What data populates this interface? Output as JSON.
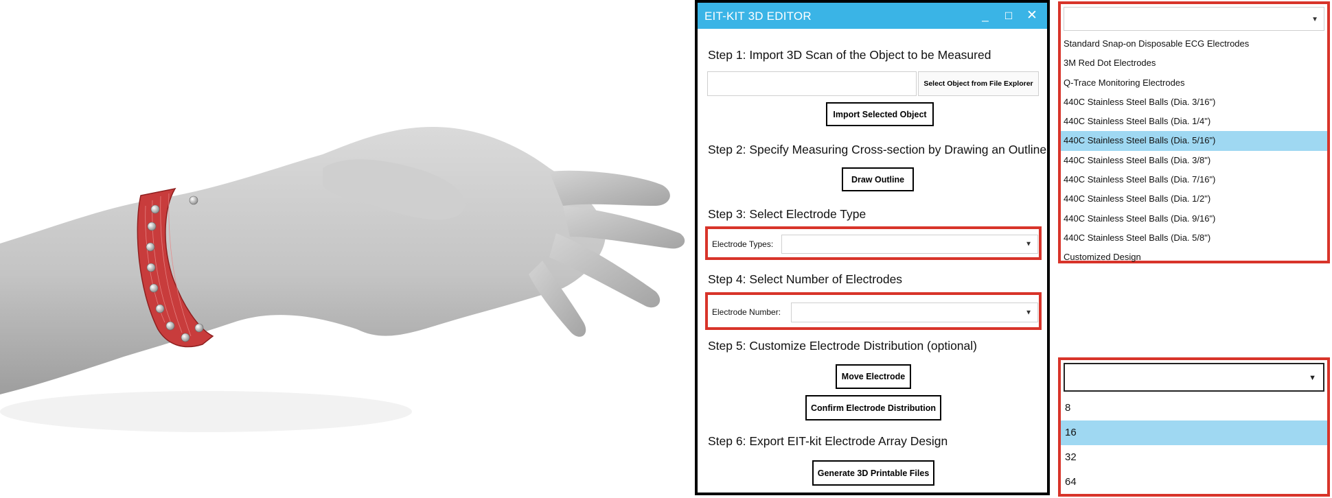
{
  "window": {
    "title": "EIT-KIT 3D EDITOR",
    "min_icon": "minimize-icon",
    "max_icon": "maximize-icon",
    "close_icon": "close-icon"
  },
  "step1": {
    "label": "Step 1: Import 3D Scan of the Object to be Measured",
    "file_value": "",
    "file_button": "Select Object from File Explorer",
    "import_button": "Import Selected Object"
  },
  "step2": {
    "label": "Step 2: Specify Measuring Cross-section by Drawing an Outline",
    "button": "Draw Outline"
  },
  "step3": {
    "label": "Step 3: Select Electrode Type",
    "field_label": "Electrode Types:",
    "value": ""
  },
  "step4": {
    "label": "Step 4: Select Number of Electrodes",
    "field_label": "Electrode Number:",
    "value": ""
  },
  "step5": {
    "label": "Step 5: Customize Electrode Distribution (optional)",
    "move_button": "Move Electrode",
    "confirm_button": "Confirm Electrode Distribution"
  },
  "step6": {
    "label": "Step 6: Export EIT-kit Electrode Array Design",
    "button": "Generate 3D Printable Files"
  },
  "electrode_types_dropdown": {
    "items": [
      "Standard Snap-on Disposable ECG Electrodes",
      "3M Red Dot Electrodes",
      "Q-Trace Monitoring Electrodes",
      "440C Stainless Steel Balls (Dia. 3/16\")",
      "440C Stainless Steel Balls (Dia. 1/4\")",
      "440C Stainless Steel Balls (Dia. 5/16\")",
      "440C Stainless Steel Balls (Dia. 3/8\")",
      "440C Stainless Steel Balls (Dia. 7/16\")",
      "440C Stainless Steel Balls (Dia. 1/2\")",
      "440C Stainless Steel Balls (Dia. 9/16\")",
      "440C Stainless Steel Balls (Dia. 5/8\")",
      "Customized Design"
    ],
    "selected_index": 5
  },
  "electrode_number_dropdown": {
    "items": [
      "8",
      "16",
      "32",
      "64"
    ],
    "selected_index": 1
  },
  "colors": {
    "accent": "#3ab4e6",
    "highlight": "#d8342a",
    "selection": "#9fd8f2",
    "band": "#c83c3c",
    "hand": "#c8c8c8"
  }
}
